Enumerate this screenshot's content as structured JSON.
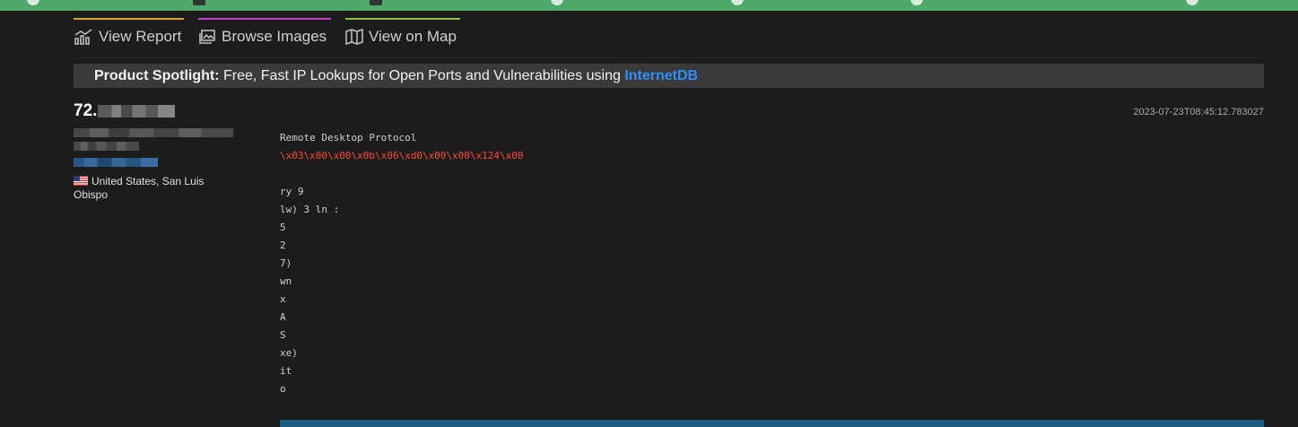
{
  "nav": {
    "items": [
      {
        "label": "View Report"
      },
      {
        "label": "Browse Images"
      },
      {
        "label": "View on Map"
      }
    ]
  },
  "spotlight": {
    "prefix": "Product Spotlight:",
    "text": " Free, Fast IP Lookups for Open Ports and Vulnerabilities using ",
    "link": "InternetDB"
  },
  "host": {
    "ip_prefix": "72.",
    "location": "United States, San Luis Obispo"
  },
  "result": {
    "timestamp": "2023-07-23T08:45:12.783027",
    "service": "Remote Desktop Protocol",
    "hex": "\\x03\\x00\\x00\\x0b\\x06\\xd0\\x00\\x00\\x124\\x00",
    "lines": [
      "",
      "ry 9",
      "lw) 3 ln :",
      "5",
      "2",
      "7)",
      "wn",
      "x",
      "A",
      "S",
      "xe)",
      "it",
      "o"
    ]
  }
}
